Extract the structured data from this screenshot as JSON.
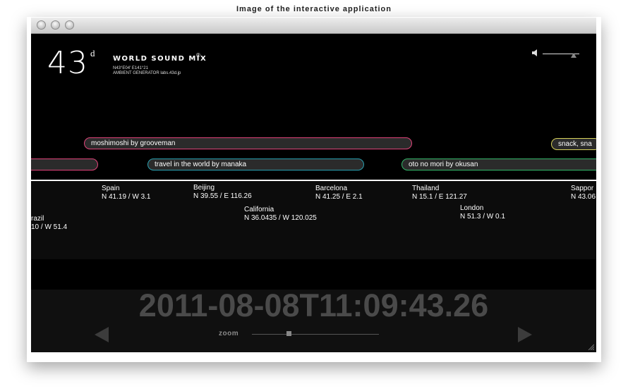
{
  "caption": "Image of the interactive application",
  "header": {
    "logo_number": "43",
    "logo_sup": "d",
    "brand": "WORLD SOUND MIX",
    "brand_mark": "®",
    "coords": "N43°E04' E141°21",
    "subtitle": "AMBIENT GENERATOR   labs.43d.jp"
  },
  "volume": {
    "icon": "speaker-icon",
    "level": 0.8
  },
  "tracks": [
    {
      "label": "moshimoshi by grooveman",
      "color": "#e0447a"
    },
    {
      "label": "snack, sna",
      "color": "#d7d25a"
    },
    {
      "label": "",
      "color": "#e0447a"
    },
    {
      "label": "travel in the world by manaka",
      "color": "#2aa0b0"
    },
    {
      "label": "oto no mori by okusan",
      "color": "#35b86a"
    }
  ],
  "cities": [
    {
      "name": "Spain",
      "coords": "N 41.19 / W 3.1"
    },
    {
      "name": "Beijing",
      "coords": "N 39.55 / E 116.26"
    },
    {
      "name": "Barcelona",
      "coords": "N 41.25 / E 2.1"
    },
    {
      "name": "Thailand",
      "coords": "N 15.1 / E 121.27"
    },
    {
      "name": "Sappor",
      "coords": "N 43.06"
    },
    {
      "name": "razil",
      "coords": "10 / W 51.4"
    },
    {
      "name": "California",
      "coords": "N 36.0435 / W 120.025"
    },
    {
      "name": "London",
      "coords": "N 51.3 / W 0.1"
    }
  ],
  "timeline": {
    "datetime": "2011-08-08T11:09:43.26",
    "zoom_label": "zoom",
    "zoom_level": 0.3
  }
}
